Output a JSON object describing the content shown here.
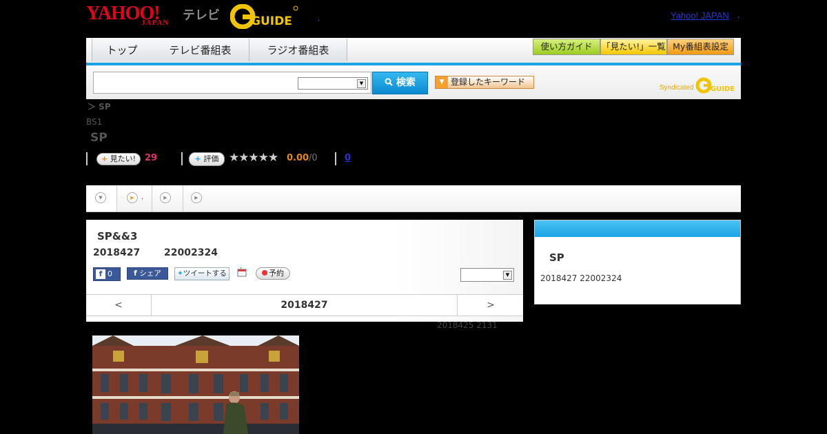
{
  "header": {
    "yahoo_logo": "YAHOO!",
    "yahoo_japan": "JAPAN",
    "tv_label": "テレビ",
    "gguide_logo": "GUIDE",
    "dot": ".",
    "yahoo_japan_link": "Yahoo! JAPAN",
    "dot2": "."
  },
  "nav": {
    "tabs": [
      {
        "label": "トップ"
      },
      {
        "label": "テレビ番組表"
      },
      {
        "label": "ラジオ番組表"
      }
    ],
    "buttons": [
      {
        "label": "使い方ガイド"
      },
      {
        "label": "「見たい!」一覧"
      },
      {
        "label": "My番組表設定"
      }
    ]
  },
  "search": {
    "input_value": "",
    "select_value": "",
    "button_label": "検索",
    "keyword_button": "登録したキーワード",
    "syndicated": "Syndicated"
  },
  "program": {
    "breadcrumb": "＞ SP",
    "station": "BS1",
    "title": "SP",
    "mitai_label": "見たい!",
    "mitai_count": "29",
    "hyoka_label": "評価",
    "stars": "★★★★★",
    "score": "0.00",
    "score_max": "/0",
    "review_count": "0"
  },
  "tabs_strip": {
    "dot": "."
  },
  "episode": {
    "title": "SP&&3",
    "date": "2018427",
    "time": "22002324",
    "fb_like_count": "0",
    "fb_share": "シェア",
    "tweet": "ツイートする",
    "yoyaku": "予約",
    "select_value": "",
    "prev": "<",
    "nav_date": "2018427",
    "next": ">",
    "updated": "2018425  2131"
  },
  "side": {
    "title": "SP",
    "subtitle": "2018427  22002324"
  },
  "colors": {
    "accent_blue": "#1aa3e4",
    "mitai_pink": "#e2336b",
    "score_orange": "#e88a1a"
  }
}
